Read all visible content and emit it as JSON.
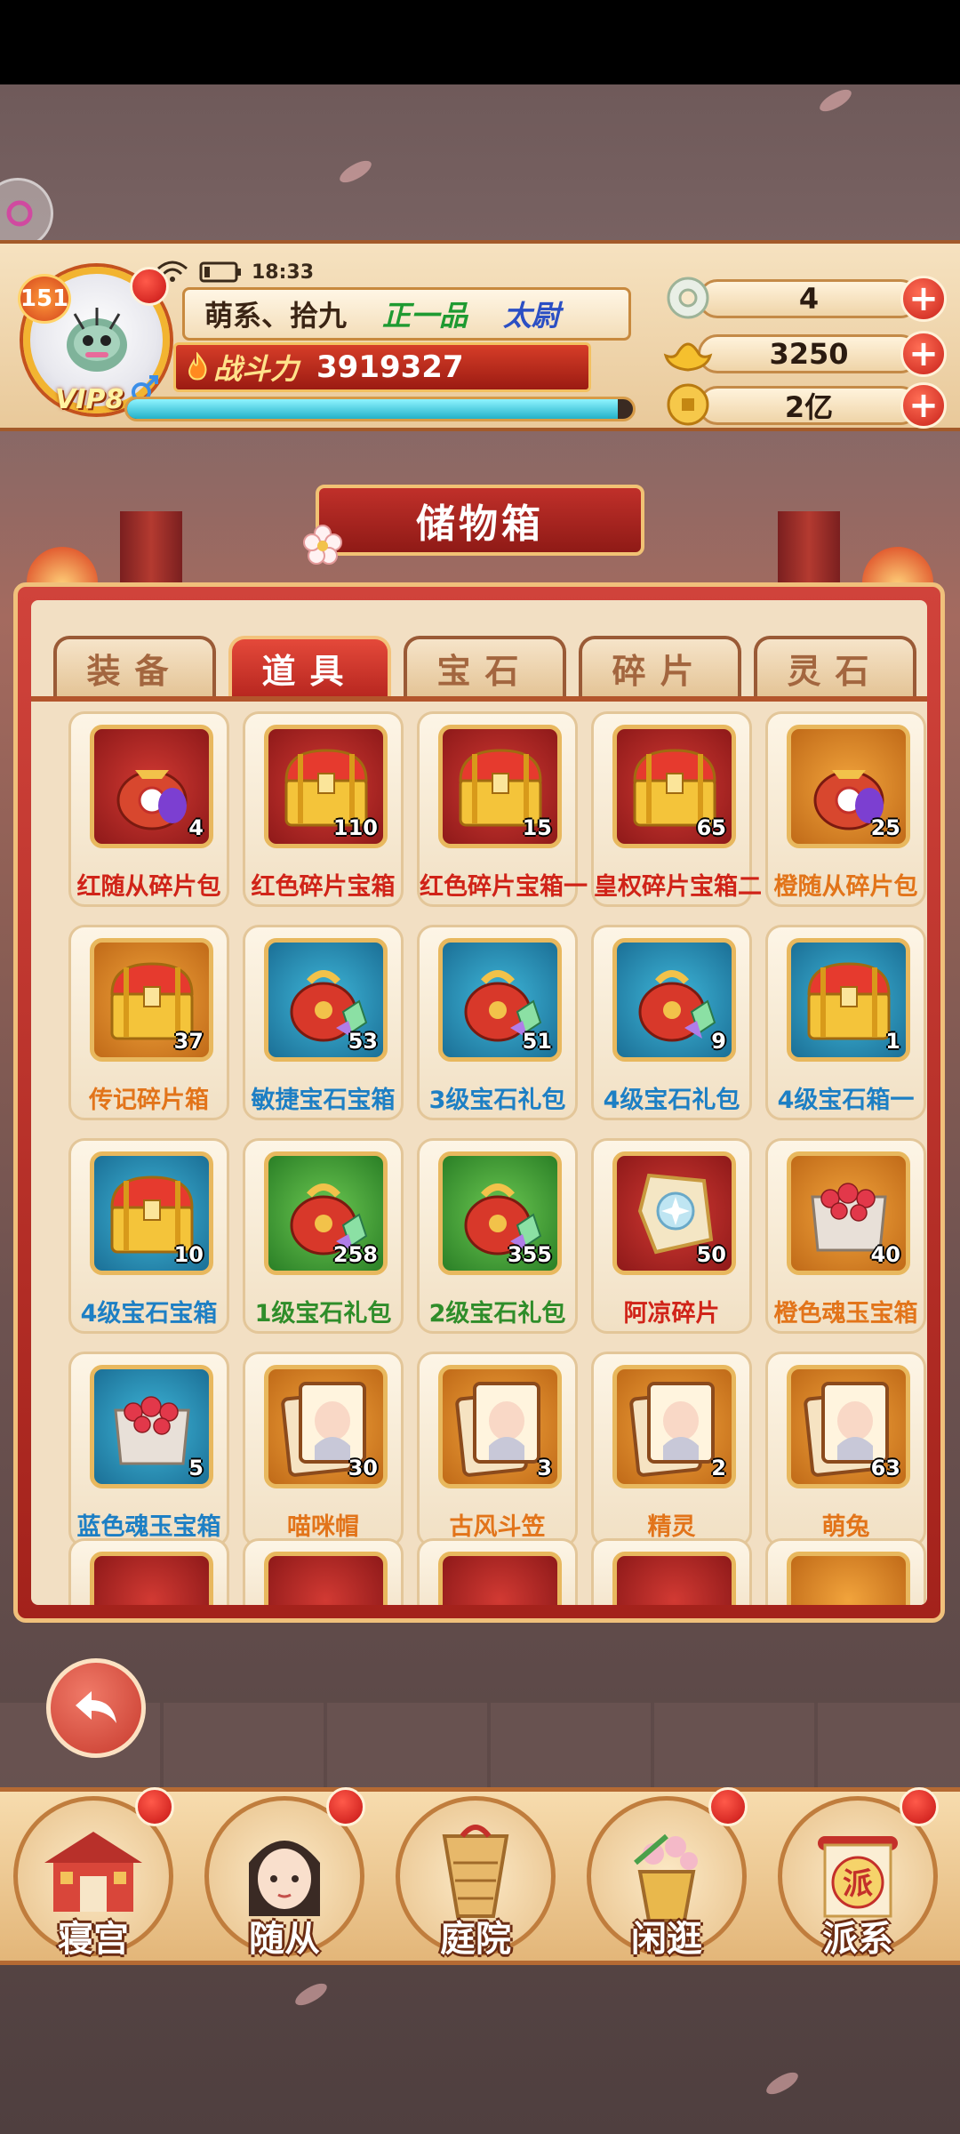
{
  "status": {
    "time": "18:33"
  },
  "player": {
    "level": "151",
    "vip": "VIP8",
    "name": "萌系、拾九",
    "rank": "正一品",
    "title": "太尉",
    "power_label": "战斗力",
    "power_value": "3919327",
    "xp_fraction": 0.97
  },
  "currencies": [
    {
      "icon": "jade-icon",
      "value": "4"
    },
    {
      "icon": "gold-ingot-icon",
      "value": "3250"
    },
    {
      "icon": "coin-icon",
      "value": "2亿"
    }
  ],
  "banner": {
    "title": "储物箱"
  },
  "tabs": [
    {
      "label": "装备",
      "active": false
    },
    {
      "label": "道具",
      "active": true
    },
    {
      "label": "宝石",
      "active": false
    },
    {
      "label": "碎片",
      "active": false
    },
    {
      "label": "灵石",
      "active": false
    }
  ],
  "items": [
    {
      "name": "红随从碎片包",
      "qty": "4",
      "frame": "red",
      "icon": "bag-icon",
      "color": "#d02318"
    },
    {
      "name": "红色碎片宝箱",
      "qty": "110",
      "frame": "red",
      "icon": "chest-icon",
      "color": "#d02318"
    },
    {
      "name": "红色碎片宝箱一",
      "qty": "15",
      "frame": "red",
      "icon": "chest-icon",
      "color": "#d02318"
    },
    {
      "name": "皇权碎片宝箱二",
      "qty": "65",
      "frame": "red",
      "icon": "chest-icon",
      "color": "#d02318"
    },
    {
      "name": "橙随从碎片包",
      "qty": "25",
      "frame": "orange",
      "icon": "bag-icon",
      "color": "#e2741a"
    },
    {
      "name": "传记碎片箱",
      "qty": "37",
      "frame": "orange",
      "icon": "chest-icon",
      "color": "#e2741a"
    },
    {
      "name": "敏捷宝石宝箱",
      "qty": "53",
      "frame": "blue",
      "icon": "gem-bag-icon",
      "color": "#1d7fc4"
    },
    {
      "name": "3级宝石礼包",
      "qty": "51",
      "frame": "blue",
      "icon": "gem-bag-icon",
      "color": "#1d7fc4"
    },
    {
      "name": "4级宝石礼包",
      "qty": "9",
      "frame": "blue",
      "icon": "gem-bag-icon",
      "color": "#1d7fc4"
    },
    {
      "name": "4级宝石箱一",
      "qty": "1",
      "frame": "blue",
      "icon": "chest-icon",
      "color": "#1d7fc4"
    },
    {
      "name": "4级宝石宝箱",
      "qty": "10",
      "frame": "blue",
      "icon": "chest-icon",
      "color": "#1d7fc4"
    },
    {
      "name": "1级宝石礼包",
      "qty": "258",
      "frame": "green",
      "icon": "gem-bag-icon",
      "color": "#2f8d2a"
    },
    {
      "name": "2级宝石礼包",
      "qty": "355",
      "frame": "green",
      "icon": "gem-bag-icon",
      "color": "#2f8d2a"
    },
    {
      "name": "阿凉碎片",
      "qty": "50",
      "frame": "red",
      "icon": "shard-icon",
      "color": "#d02318"
    },
    {
      "name": "橙色魂玉宝箱",
      "qty": "40",
      "frame": "orange",
      "icon": "jewel-chest-icon",
      "color": "#e2741a"
    },
    {
      "name": "蓝色魂玉宝箱",
      "qty": "5",
      "frame": "blue",
      "icon": "jewel-chest-icon",
      "color": "#1d7fc4"
    },
    {
      "name": "喵咪帽",
      "qty": "30",
      "frame": "orange",
      "icon": "card-icon",
      "color": "#e2741a"
    },
    {
      "name": "古风斗笠",
      "qty": "3",
      "frame": "orange",
      "icon": "card-icon",
      "color": "#e2741a"
    },
    {
      "name": "精灵",
      "qty": "2",
      "frame": "orange",
      "icon": "card-icon",
      "color": "#e2741a"
    },
    {
      "name": "萌兔",
      "qty": "63",
      "frame": "orange",
      "icon": "card-icon",
      "color": "#e2741a"
    }
  ],
  "partial_row_frames": [
    "red",
    "red",
    "red",
    "red",
    "orange"
  ],
  "nav": [
    {
      "label": "寝宫",
      "icon": "palace-icon"
    },
    {
      "label": "随从",
      "icon": "follower-icon"
    },
    {
      "label": "庭院",
      "icon": "courtyard-icon"
    },
    {
      "label": "闲逛",
      "icon": "stroll-icon"
    },
    {
      "label": "派系",
      "icon": "faction-icon"
    }
  ],
  "faction_glyph": "派"
}
